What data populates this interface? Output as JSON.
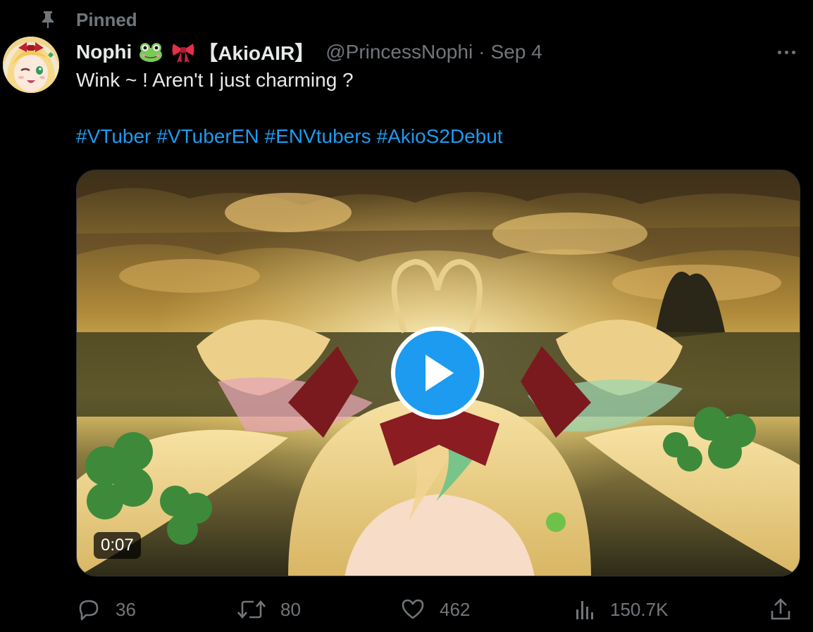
{
  "pinned": {
    "label": "Pinned",
    "icon": "pin-icon"
  },
  "author": {
    "display_name": "Nophi",
    "emojis": [
      "frog-emoji",
      "ribbon-emoji"
    ],
    "name_tag": "【AkioAIR】",
    "handle": "@PrincessNophi",
    "separator": "·",
    "date": "Sep 4"
  },
  "tweet": {
    "text": "Wink ~ ! Aren't I just charming ?",
    "hashtags": [
      "#VTuber",
      "#VTuberEN",
      "#ENVtubers",
      "#AkioS2Debut"
    ]
  },
  "media": {
    "type": "video",
    "duration": "0:07",
    "play_icon": "play-icon"
  },
  "actions": {
    "replies": {
      "icon": "reply-icon",
      "count": "36"
    },
    "retweets": {
      "icon": "retweet-icon",
      "count": "80"
    },
    "likes": {
      "icon": "heart-icon",
      "count": "462"
    },
    "views": {
      "icon": "views-icon",
      "count": "150.7K"
    },
    "share": {
      "icon": "share-icon"
    }
  },
  "colors": {
    "background": "#000000",
    "text": "#e7e9ea",
    "muted": "#71767b",
    "accent": "#1d9bf0"
  }
}
